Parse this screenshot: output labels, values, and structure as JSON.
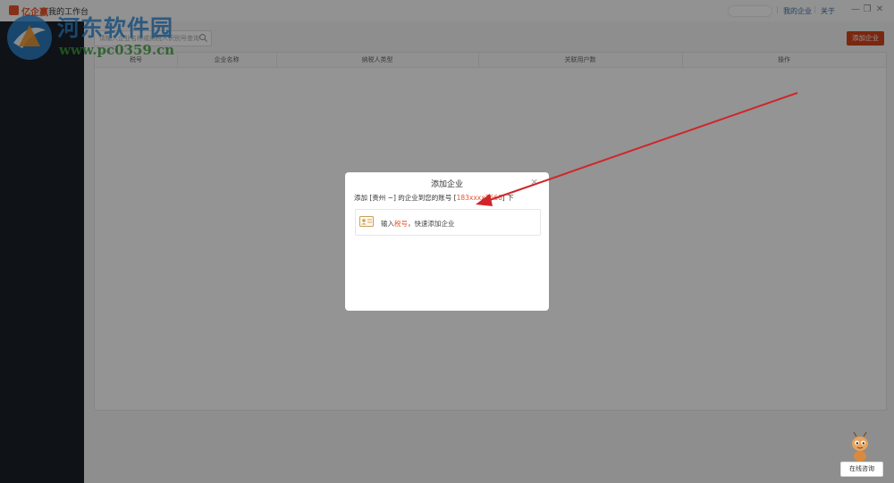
{
  "titlebar": {
    "logo_text": "亿企赢",
    "app_title": "我的工作台",
    "links": [
      "我的企业",
      "关于"
    ],
    "separator": "|",
    "window_buttons": {
      "minimize": "—",
      "restore": "❐",
      "close": "✕"
    }
  },
  "toolbar": {
    "search_placeholder": "请输入企业名称或纳税人识别号查询",
    "add_button": "添加企业"
  },
  "table": {
    "headers": [
      "税号",
      "企业名称",
      "纳税人类型",
      "关联用户数",
      "操作"
    ]
  },
  "modal": {
    "title": "添加企业",
    "close": "×",
    "desc_prefix": "添加 [贵州 ~] 的企业到您的账号 [",
    "account": "183xxxx7666",
    "desc_suffix": "] 下",
    "option_prefix": "输入",
    "option_highlight": "税号",
    "option_suffix": "，快速添加企业"
  },
  "watermark": {
    "title": "河东软件园",
    "url": "www.pc0359.cn"
  },
  "consult_button": "在线咨询",
  "colors": {
    "accent": "#d2441c",
    "sidebar": "#1b2029",
    "watermark_blue": "#2e89d6",
    "watermark_green": "#3ca03c",
    "arrow": "#d0262a"
  }
}
